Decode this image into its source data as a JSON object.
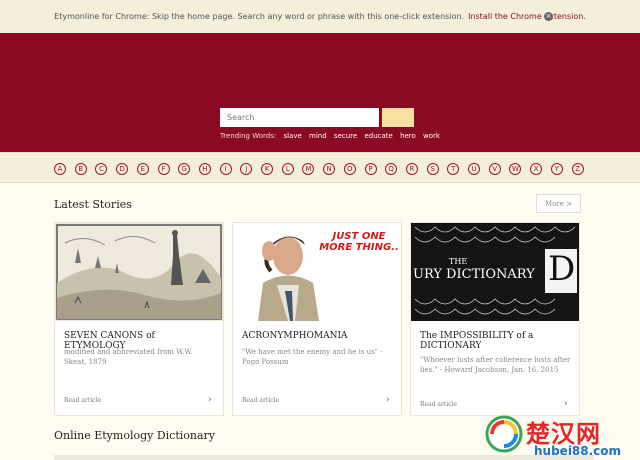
{
  "notice": {
    "text": "Etymonline for Chrome: Skip the home page. Search any word or phrase with this one-click extension.",
    "link": "Install the Chrome extension."
  },
  "search": {
    "placeholder": "Search"
  },
  "trending": {
    "label": "Trending Words:",
    "words": [
      "slave",
      "mind",
      "secure",
      "educate",
      "hero",
      "work"
    ]
  },
  "alphabet": [
    "A",
    "B",
    "C",
    "D",
    "E",
    "F",
    "G",
    "H",
    "I",
    "J",
    "K",
    "L",
    "M",
    "N",
    "O",
    "P",
    "Q",
    "R",
    "S",
    "T",
    "U",
    "V",
    "W",
    "X",
    "Y",
    "Z"
  ],
  "latest": {
    "heading": "Latest Stories",
    "more": "More >",
    "read": "Read article",
    "cards": [
      {
        "title": "SEVEN CANONS of ETYMOLOGY",
        "subtitle": "modified and abbreviated from W.W. Skeat, 1879"
      },
      {
        "title": "ACRONYMPHOMANIA",
        "subtitle": "\"We have met the enemy and he is us\" - Pogo Possum",
        "image_text": "JUST ONE MORE THING.."
      },
      {
        "title": "The IMPOSSIBILITY of a DICTIONARY",
        "subtitle": "\"Whoever lusts after coherence lusts after lies.\" - Howard Jacobson, Jan. 16, 2015",
        "image_text_a": "THE",
        "image_text_b": "URY DICTIONARY",
        "image_text_c": "D"
      }
    ]
  },
  "dictionary": {
    "heading": "Online Etymology Dictionary"
  },
  "watermark": {
    "text": "楚汉网",
    "url": "hubei88.com"
  },
  "colors": {
    "brand": "#8a0a23",
    "accent": "#f6e1a3",
    "cream": "#fefcf0"
  }
}
